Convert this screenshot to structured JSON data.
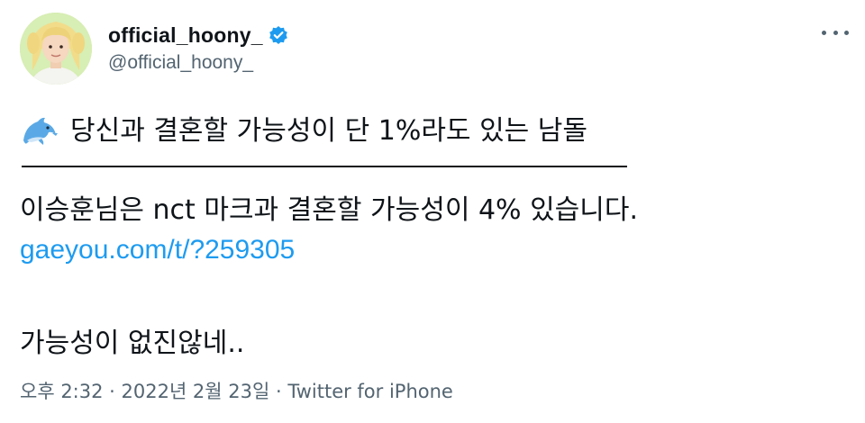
{
  "author": {
    "display_name": "official_hoony_",
    "handle": "@official_hoony_",
    "verified": true
  },
  "tweet": {
    "line1_icon": "dolphin-icon",
    "line1": "당신과 결혼할 가능성이 단 1%라도 있는 남돌",
    "divider": "——————————————",
    "line2": "이승훈님은 nct 마크과 결혼할 가능성이 4% 있습니다.",
    "link": "gaeyou.com/t/?259305",
    "line3": "가능성이 없진않네..",
    "meta": "오후 2:32 · 2022년 2월 23일 · Twitter for iPhone"
  },
  "colors": {
    "link": "#1d9bf0",
    "verified": "#1d9bf0",
    "secondary_text": "#536471",
    "primary_text": "#0f1419"
  },
  "icons": {
    "more": "more-dots-icon",
    "verified": "verified-badge-icon",
    "avatar": "avatar"
  }
}
